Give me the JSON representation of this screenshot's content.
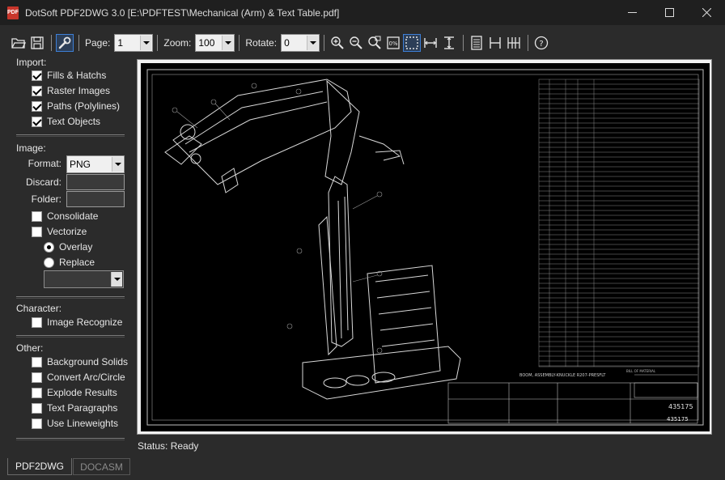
{
  "window": {
    "title": "DotSoft PDF2DWG 3.0 [E:\\PDFTEST\\Mechanical (Arm) & Text Table.pdf]",
    "icon_label": "PDF"
  },
  "toolbar": {
    "page_label": "Page:",
    "page_value": "1",
    "zoom_label": "Zoom:",
    "zoom_value": "100",
    "rotate_label": "Rotate:",
    "rotate_value": "0"
  },
  "import": {
    "title": "Import:",
    "items": [
      {
        "label": "Fills & Hatchs",
        "checked": true
      },
      {
        "label": "Raster Images",
        "checked": true
      },
      {
        "label": "Paths (Polylines)",
        "checked": true
      },
      {
        "label": "Text Objects",
        "checked": true
      }
    ]
  },
  "image": {
    "title": "Image:",
    "format_label": "Format:",
    "format_value": "PNG",
    "discard_label": "Discard:",
    "folder_label": "Folder:",
    "consolidate_label": "Consolidate",
    "vectorize_label": "Vectorize",
    "overlay_label": "Overlay",
    "replace_label": "Replace"
  },
  "character": {
    "title": "Character:",
    "image_recognize_label": "Image Recognize"
  },
  "other": {
    "title": "Other:",
    "items": [
      {
        "label": "Background Solids",
        "checked": false
      },
      {
        "label": "Convert Arc/Circle",
        "checked": false
      },
      {
        "label": "Explode Results",
        "checked": false
      },
      {
        "label": "Text Paragraphs",
        "checked": false
      },
      {
        "label": "Use Lineweights",
        "checked": false
      }
    ]
  },
  "tabs": [
    {
      "label": "PDF2DWG",
      "active": true
    },
    {
      "label": "DOCASM",
      "active": false
    }
  ],
  "status": {
    "text": "Status: Ready"
  },
  "drawing": {
    "title_block_text": "BOOM, ASSEMBLY-KNUCKLE R207-PRESFLT",
    "drawing_number": "435175",
    "bill_of_material_label": "BILL OF MATERIAL"
  },
  "colors": {
    "window_bg": "#2b2b2b",
    "titlebar_bg": "#1f1f1f",
    "accent": "#3d7fd6",
    "drawing_bg": "#000000"
  }
}
